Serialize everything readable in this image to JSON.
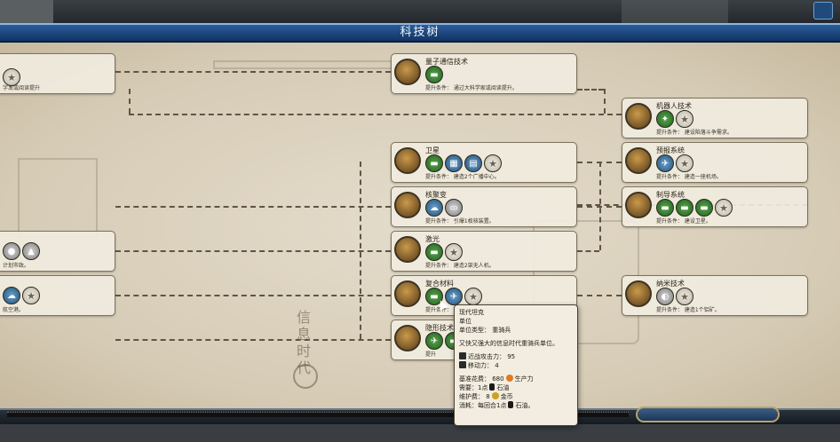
{
  "window": {
    "title": "科技树"
  },
  "era": {
    "label": "信息时代"
  },
  "techs": [
    {
      "id": "partial-left-1",
      "name": "",
      "desc": "字发或阅读提升",
      "icons": [
        "star-icon"
      ]
    },
    {
      "id": "quantum",
      "name": "量子通信技术",
      "desc": "提升条件：  通过大科学家或阅读提升。",
      "icons": [
        "unit-icon"
      ]
    },
    {
      "id": "robotics",
      "name": "机器人技术",
      "desc": "提升条件：  建设陷落斗争需求。",
      "icons": [
        "unit-icon",
        "star-icon"
      ]
    },
    {
      "id": "satellite",
      "name": "卫星",
      "desc": "提升条件：  建造2个广播中心。",
      "icons": [
        "unit-icon",
        "unit-icon",
        "unit-icon",
        "star-icon"
      ]
    },
    {
      "id": "forecast",
      "name": "预报系统",
      "desc": "提升条件：  建造一座机场。",
      "icons": [
        "unit-icon",
        "star-icon"
      ]
    },
    {
      "id": "fusion",
      "name": "核聚变",
      "desc": "提升条件：  引爆1枚核装置。",
      "icons": [
        "unit-icon",
        "unit-icon"
      ]
    },
    {
      "id": "guidance",
      "name": "制导系统",
      "desc": "提升条件：  建设卫星。",
      "icons": [
        "unit-icon",
        "unit-icon",
        "unit-icon",
        "star-icon"
      ]
    },
    {
      "id": "laser",
      "name": "激光",
      "desc": "提升条件：  建造2架无人机。",
      "icons": [
        "unit-icon",
        "star-icon"
      ]
    },
    {
      "id": "partial-left-2",
      "name": "",
      "desc": "计划市政。",
      "icons": [
        "unit-icon",
        "unit-icon"
      ]
    },
    {
      "id": "composite",
      "name": "复合材料",
      "desc": "提升条件：",
      "icons": [
        "unit-icon",
        "unit-icon",
        "star-icon"
      ]
    },
    {
      "id": "nanotech",
      "name": "纳米技术",
      "desc": "提升条件：  建造1个铝矿。",
      "icons": [
        "unit-icon",
        "star-icon"
      ]
    },
    {
      "id": "partial-left-3",
      "name": "",
      "desc": "航空港。",
      "icons": [
        "unit-icon",
        "star-icon"
      ]
    },
    {
      "id": "stealth",
      "name": "隐形技术",
      "desc": "提升",
      "icons": [
        "unit-icon",
        "unit-icon"
      ]
    }
  ],
  "tooltip": {
    "title": "现代坦克",
    "subtitle": "单位",
    "type_line": "单位类型：  重骑兵",
    "desc": "又快又强大的信息时代重骑兵单位。",
    "melee": "近战攻击力：  95",
    "move": "移动力：  4",
    "cost_label": "基准花费：  680",
    "cost_unit": "生产力",
    "require_label": "需要：1点",
    "require_res": "石油",
    "upkeep_label": "维护费：  8",
    "upkeep_unit": "金币",
    "consume_label": "消耗：每回合1点",
    "consume_res": "石油。"
  }
}
